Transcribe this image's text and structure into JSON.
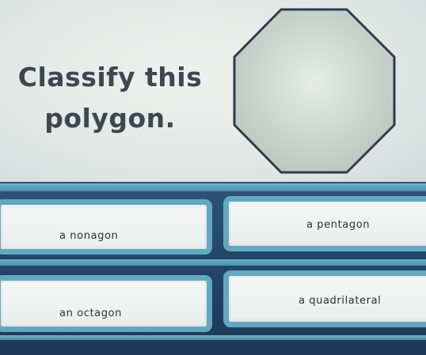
{
  "question": {
    "prompt_line1": "Classify this",
    "prompt_line2": "polygon.",
    "shape_icon": "octagon-icon",
    "shape_fill": "#c8d2cc",
    "shape_stroke": "#2f3b4d"
  },
  "answers": [
    {
      "label": "a nonagon"
    },
    {
      "label": "a pentagon"
    },
    {
      "label": "an octagon"
    },
    {
      "label": "a quadrilateral"
    }
  ],
  "colors": {
    "card_border": "#63a7c0",
    "panel_background": "#24476a"
  }
}
